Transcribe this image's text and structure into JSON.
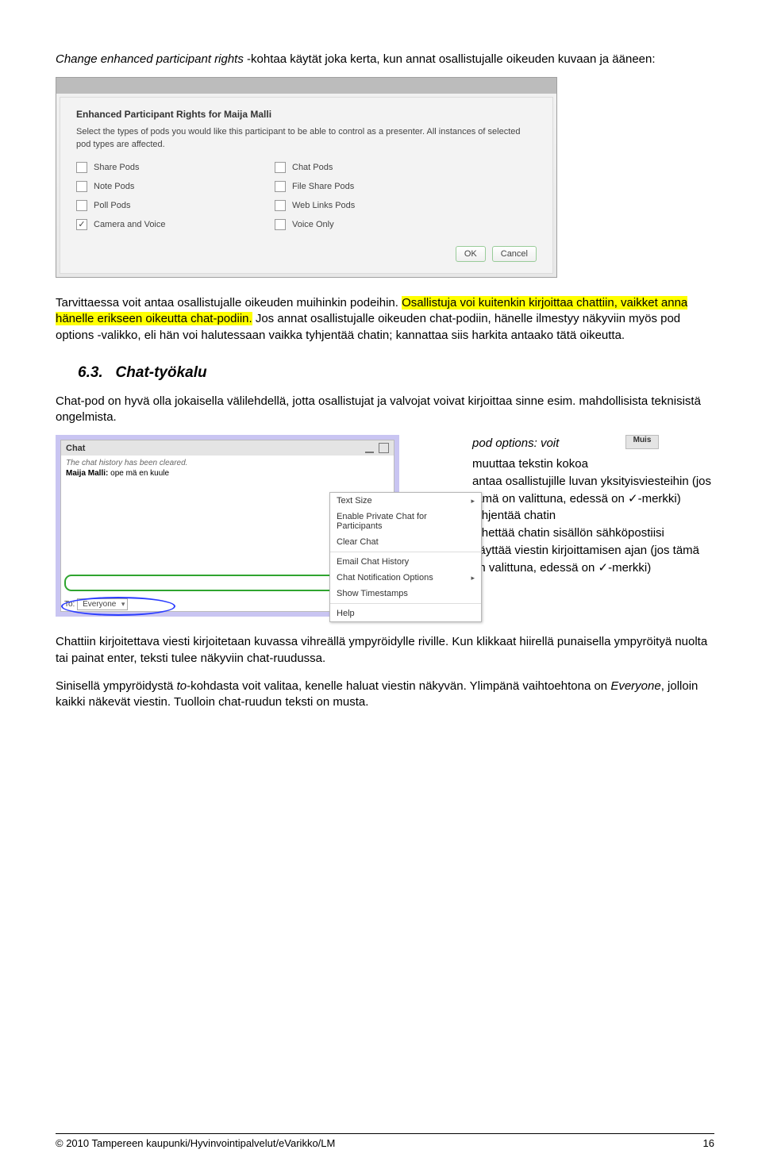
{
  "intro": {
    "p1_italic": "Change enhanced participant rights",
    "p1_rest": " -kohtaa käytät joka kerta, kun annat osallistujalle oikeuden kuvaan ja ääneen:"
  },
  "dialog": {
    "title": "Enhanced Participant Rights for  Maija Malli",
    "sub": "Select the types of pods you would like this participant to be able to control as a presenter. All instances of selected pod types are affected.",
    "checks": [
      {
        "label": "Share Pods",
        "checked": false
      },
      {
        "label": "Chat Pods",
        "checked": false
      },
      {
        "label": "Note Pods",
        "checked": false
      },
      {
        "label": "File Share Pods",
        "checked": false
      },
      {
        "label": "Poll Pods",
        "checked": false
      },
      {
        "label": "Web Links Pods",
        "checked": false
      },
      {
        "label": "Camera and Voice",
        "checked": true
      },
      {
        "label": "Voice Only",
        "checked": false
      }
    ],
    "ok": "OK",
    "cancel": "Cancel"
  },
  "mid": {
    "p2": "Tarvittaessa voit antaa osallistujalle oikeuden muihinkin podeihin. ",
    "hl": "Osallistuja voi kuitenkin kirjoittaa chattiin, vaikket anna hänelle erikseen oikeutta chat-podiin.",
    "p2b": " Jos annat osallistujalle oikeuden chat-podiin, hänelle ilmestyy näkyviin myös pod options -valikko, eli hän voi halutessaan vaikka tyhjentää chatin; kannattaa siis harkita antaako tätä oikeutta."
  },
  "section": {
    "num": "6.3.",
    "title": "Chat-työkalu",
    "p": "Chat-pod on hyvä olla jokaisella välilehdellä, jotta osallistujat ja valvojat voivat kirjoittaa sinne esim. mahdollisista teknisistä ongelmista."
  },
  "chat": {
    "title": "Chat",
    "muis": "Muis",
    "cleared": "The chat history has been cleared.",
    "line_author": "Maija Malli:",
    "line_text": " ope mä en kuule",
    "to_label": "To:",
    "to_value": "Everyone",
    "menu": [
      {
        "label": "Text Size",
        "arrow": true
      },
      {
        "label": "Enable Private Chat for Participants",
        "arrow": false
      },
      {
        "label": "Clear Chat",
        "arrow": false
      },
      {
        "sep": true
      },
      {
        "label": "Email Chat History",
        "arrow": false
      },
      {
        "label": "Chat Notification Options",
        "arrow": true
      },
      {
        "label": "Show Timestamps",
        "arrow": false
      },
      {
        "sep": true
      },
      {
        "label": "Help",
        "arrow": false
      }
    ]
  },
  "options": {
    "title_a": "pod options:",
    "title_b": " voit",
    "l1": "muuttaa tekstin kokoa",
    "l2a": "antaa osallistujille luvan yksityisviesteihin (jos tämä on valittuna, edessä on ",
    "l2b": "-merkki)",
    "l3": "tyhjentää chatin",
    "l4": "lähettää chatin sisällön sähköpostiisi",
    "l5a": "näyttää viestin kirjoittamisen ajan (jos tämä on valittuna, edessä on ",
    "l5b": "-merkki)"
  },
  "after": {
    "p1": "Chattiin kirjoitettava viesti kirjoitetaan kuvassa vihreällä ympyröidylle riville. Kun klikkaat hiirellä punaisella ympyröityä nuolta tai painat enter, teksti tulee näkyviin chat-ruudussa.",
    "p2a": "Sinisellä ympyröidystä ",
    "p2_italic": "to",
    "p2b": "-kohdasta voit valitaa, kenelle haluat viestin näkyvän. Ylimpänä vaihtoehtona on ",
    "p2_italic2": "Everyone",
    "p2c": ", jolloin kaikki näkevät viestin. Tuolloin chat-ruudun teksti on musta."
  },
  "footer": {
    "left": "© 2010 Tampereen kaupunki/Hyvinvointipalvelut/eVarikko/LM",
    "right": "16"
  }
}
